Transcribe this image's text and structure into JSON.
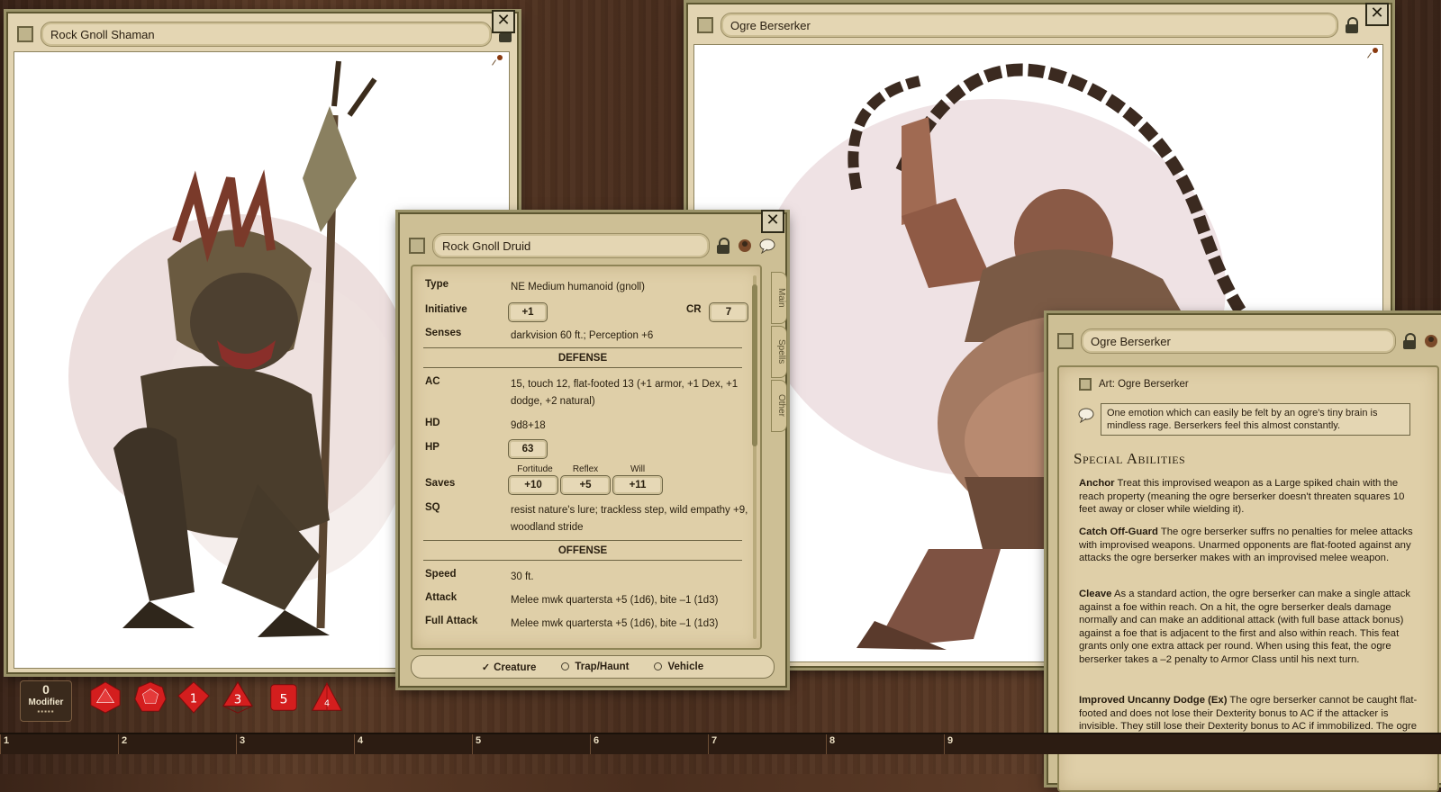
{
  "windows": {
    "shaman": {
      "title": "Rock Gnoll Shaman"
    },
    "ogre_image": {
      "title": "Ogre Berserker"
    },
    "druid": {
      "title": "Rock Gnoll Druid",
      "tabs": [
        "Main",
        "Spells",
        "Other"
      ],
      "type_label": "Type",
      "type_value": "NE Medium humanoid (gnoll)",
      "initiative_label": "Initiative",
      "initiative_value": "+1",
      "cr_label": "CR",
      "cr_value": "7",
      "senses_label": "Senses",
      "senses_value": "darkvision 60 ft.; Perception +6",
      "defense_header": "DEFENSE",
      "ac_label": "AC",
      "ac_value": "15, touch 12, flat-footed 13 (+1 armor, +1 Dex, +1 dodge, +2 natural)",
      "hd_label": "HD",
      "hd_value": "9d8+18",
      "hp_label": "HP",
      "hp_value": "63",
      "saves_label": "Saves",
      "fort_label": "Fortitude",
      "fort_value": "+10",
      "ref_label": "Reflex",
      "ref_value": "+5",
      "will_label": "Will",
      "will_value": "+11",
      "sq_label": "SQ",
      "sq_value": "resist nature's lure; trackless step, wild empathy +9, woodland stride",
      "offense_header": "OFFENSE",
      "speed_label": "Speed",
      "speed_value": "30 ft.",
      "attack_label": "Attack",
      "attack_value": "Melee mwk quartersta +5 (1d6), bite –1 (1d3)",
      "full_attack_label": "Full Attack",
      "full_attack_value": "Melee mwk quartersta +5 (1d6), bite –1 (1d3)",
      "type_options": [
        "Creature",
        "Trap/Haunt",
        "Vehicle"
      ],
      "selected_type": "Creature"
    },
    "ogre_text": {
      "title": "Ogre Berserker",
      "art_link": "Art: Ogre Berserker",
      "quote": "One emotion which can easily be felt by an ogre's tiny brain is mindless rage. Berserkers feel this almost constantly.",
      "section_title": "Special Abilities",
      "abilities": [
        {
          "name": "Anchor",
          "text": "Treat this improvised weapon as a Large spiked chain with the reach property (meaning the ogre berserker doesn't threaten squares 10 feet away or closer while wielding it)."
        },
        {
          "name": "Catch Off-Guard",
          "text": "The ogre berserker suffrs no penalties for melee attacks with improvised weapons. Unarmed opponents are flat-footed against any attacks the ogre berserker makes with an improvised melee weapon."
        },
        {
          "name": "Cleave",
          "text": "As a standard action, the ogre berserker can make a single attack against a foe within reach. On a hit, the ogre berserker deals damage normally and can make an additional attack (with full base attack bonus) against a foe that is adjacent to the first and also within reach. This feat grants only one extra attack per round. When using this feat, the ogre berserker takes a –2 penalty to Armor Class until his next turn."
        },
        {
          "name": "Improved Uncanny Dodge (Ex)",
          "text": "The ogre berserker cannot be caught flat-footed and does not lose their Dexterity bonus to AC if the attacker is invisible. They still lose their Dexterity bonus to AC if immobilized. The ogre berserker can still lose their Dexterity"
        }
      ]
    }
  },
  "modifier": {
    "value": "0",
    "label": "Modifier"
  },
  "dice": [
    "d20",
    "d12",
    "d10",
    "d8",
    "d6",
    "d4"
  ],
  "hotbar": [
    "1",
    "2",
    "3",
    "4",
    "5",
    "6",
    "7",
    "8",
    "9"
  ],
  "colors": {
    "parchment": "#dfcfa8",
    "frame": "#5e5731",
    "dice": "#d41e1e",
    "wood": "#4a2e1e"
  }
}
